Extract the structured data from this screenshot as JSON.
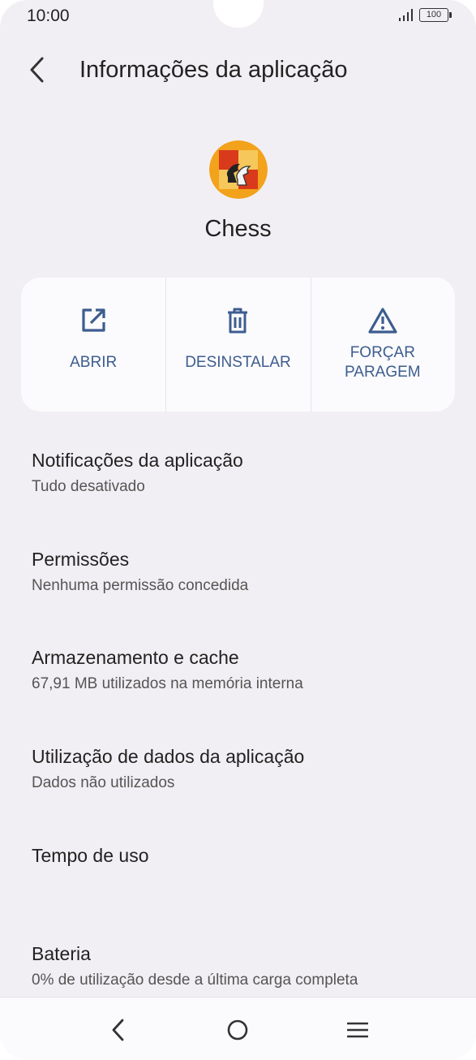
{
  "status_bar": {
    "time": "10:00",
    "battery": "100"
  },
  "header": {
    "title": "Informações da aplicação"
  },
  "app": {
    "name": "Chess"
  },
  "actions": [
    {
      "label": "ABRIR",
      "icon": "open-external-icon"
    },
    {
      "label": "DESINSTALAR",
      "icon": "trash-icon"
    },
    {
      "label": "FORÇAR\nPARAGEM",
      "icon": "warning-icon"
    }
  ],
  "settings": [
    {
      "title": "Notificações da aplicação",
      "subtitle": "Tudo desativado"
    },
    {
      "title": "Permissões",
      "subtitle": "Nenhuma permissão concedida"
    },
    {
      "title": "Armazenamento e cache",
      "subtitle": "67,91 MB utilizados na memória interna"
    },
    {
      "title": "Utilização de dados da aplicação",
      "subtitle": "Dados não utilizados"
    },
    {
      "title": "Tempo de uso",
      "subtitle": ""
    },
    {
      "title": "Bateria",
      "subtitle": "0% de utilização desde a última carga completa"
    }
  ],
  "colors": {
    "accent": "#3c5d8f",
    "background": "#f1eff3",
    "card": "#fbfafc"
  }
}
